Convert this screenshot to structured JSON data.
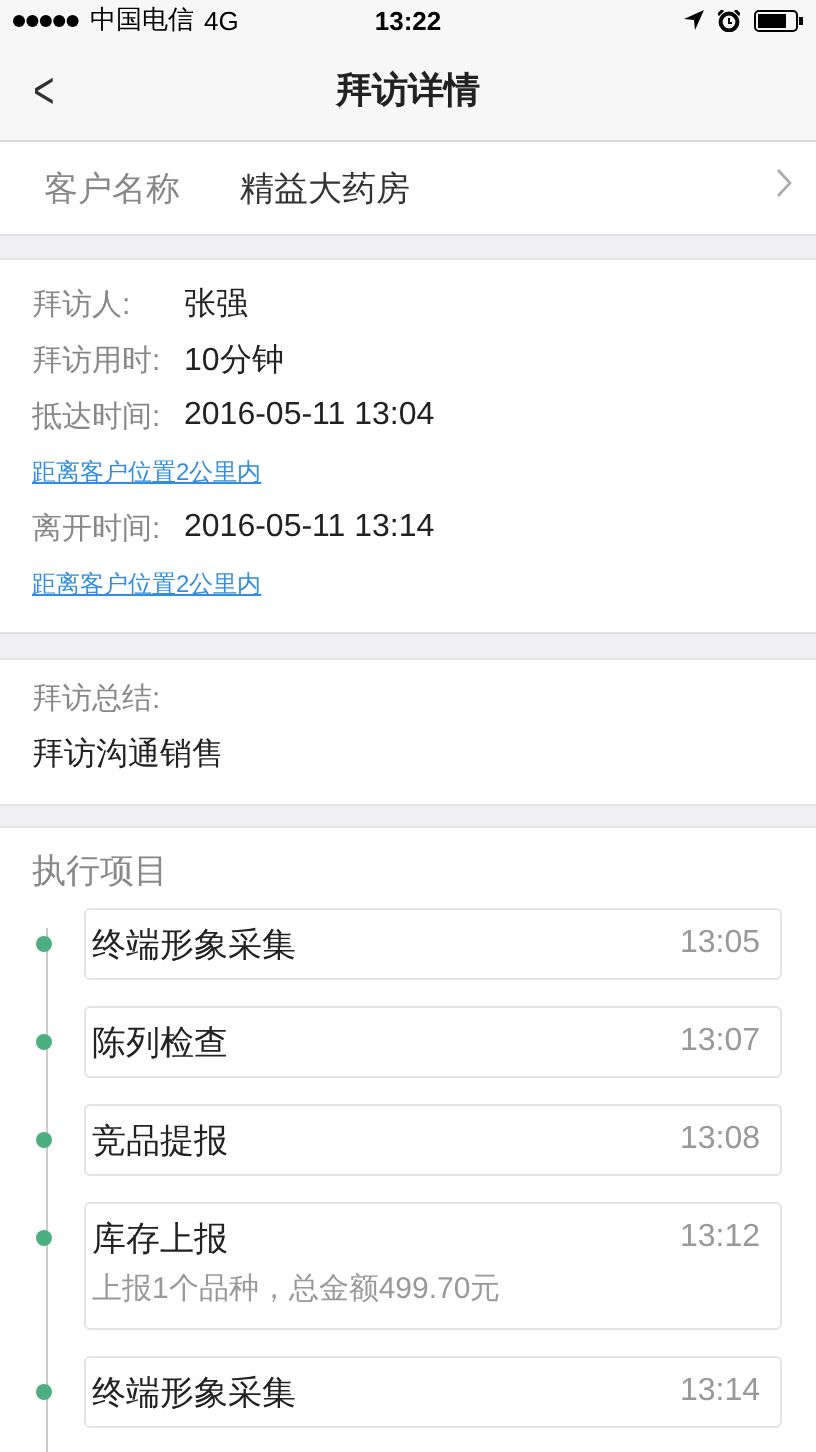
{
  "status_bar": {
    "carrier": "中国电信",
    "network": "4G",
    "time": "13:22"
  },
  "nav": {
    "back": "<",
    "title": "拜访详情"
  },
  "customer": {
    "label": "客户名称",
    "value": "精益大药房"
  },
  "visit_info": [
    {
      "kind": "field",
      "label": "拜访人:",
      "value": "张强"
    },
    {
      "kind": "field",
      "label": "拜访用时:",
      "value": "10分钟"
    },
    {
      "kind": "field",
      "label": "抵达时间:",
      "value": "2016-05-11 13:04"
    },
    {
      "kind": "link",
      "text": "距离客户位置2公里内"
    },
    {
      "kind": "field",
      "label": "离开时间:",
      "value": "2016-05-11 13:14"
    },
    {
      "kind": "link",
      "text": "距离客户位置2公里内"
    }
  ],
  "summary": {
    "label": "拜访总结:",
    "text": "拜访沟通销售"
  },
  "tasks": {
    "title": "执行项目",
    "items": [
      {
        "name": "终端形象采集",
        "time": "13:05"
      },
      {
        "name": "陈列检查",
        "time": "13:07"
      },
      {
        "name": "竞品提报",
        "time": "13:08"
      },
      {
        "name": "库存上报",
        "time": "13:12",
        "detail": "上报1个品种，总金额499.70元"
      },
      {
        "name": "终端形象采集",
        "time": "13:14"
      }
    ]
  }
}
